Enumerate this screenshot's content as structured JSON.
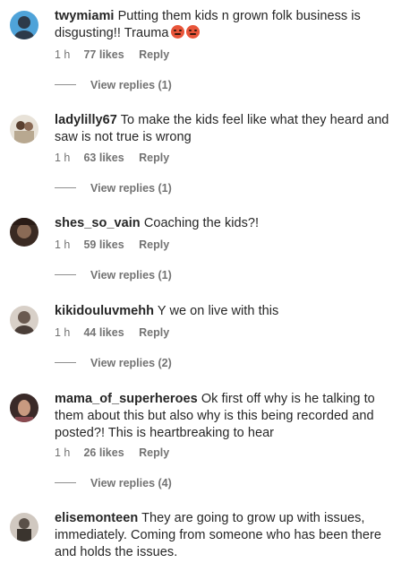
{
  "comments": [
    {
      "username": "twymiami",
      "text": "Putting them kids n grown folk business is disgusting!! Trauma",
      "emojis": [
        "angry-face",
        "angry-face"
      ],
      "time": "1 h",
      "likes": "77 likes",
      "reply": "Reply",
      "view_replies": "View replies (1)",
      "avatar_colors": [
        "#4fa3d9",
        "#2d3a4a"
      ]
    },
    {
      "username": "ladylilly67",
      "text": "To make the kids feel like what they heard and saw is not true is wrong",
      "time": "1 h",
      "likes": "63 likes",
      "reply": "Reply",
      "view_replies": "View replies (1)",
      "avatar_colors": [
        "#b8a890",
        "#5a4030"
      ]
    },
    {
      "username": "shes_so_vain",
      "text": "Coaching the kids?!",
      "time": "1 h",
      "likes": "59 likes",
      "reply": "Reply",
      "view_replies": "View replies (1)",
      "avatar_colors": [
        "#3a2a22",
        "#8a6a55"
      ]
    },
    {
      "username": "kikidouluvmehh",
      "text": "Y we on live with this",
      "time": "1 h",
      "likes": "44 likes",
      "reply": "Reply",
      "view_replies": "View replies (2)",
      "avatar_colors": [
        "#6a5a50",
        "#d8d0c8"
      ]
    },
    {
      "username": "mama_of_superheroes",
      "text": "Ok first off why is he talking to them about this but also why is this being recorded and posted?! This is heartbreaking to hear",
      "time": "1 h",
      "likes": "26 likes",
      "reply": "Reply",
      "view_replies": "View replies (4)",
      "avatar_colors": [
        "#3a2a28",
        "#c89a80"
      ]
    },
    {
      "username": "elisemonteen",
      "text": "They are going to grow up with issues, immediately. Coming from someone who has been there and holds the issues.",
      "avatar_colors": [
        "#5a5048",
        "#d0c8c0"
      ]
    }
  ]
}
